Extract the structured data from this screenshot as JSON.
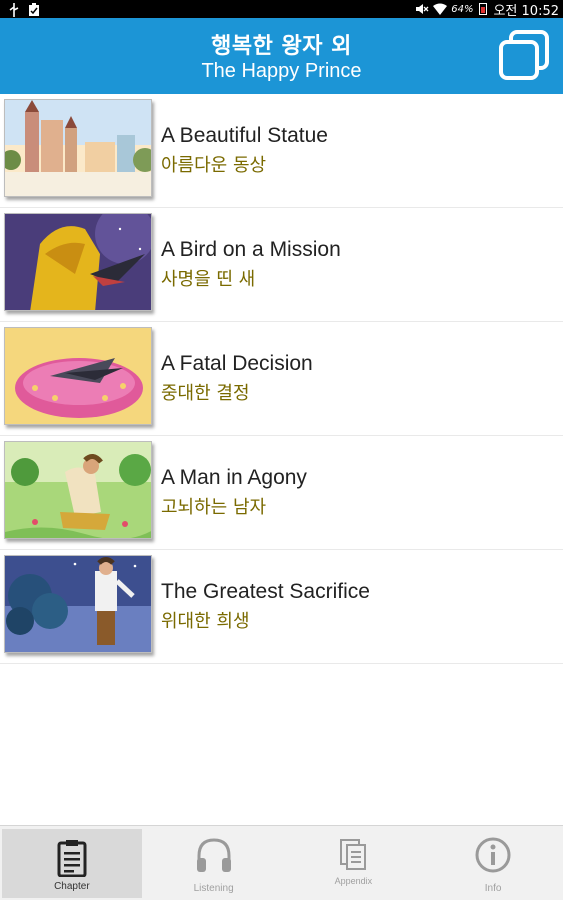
{
  "status_bar": {
    "left_icons": [
      "usb-icon",
      "clipboard-notification-icon"
    ],
    "battery_percent": "64%",
    "time": "오전 10:52"
  },
  "header": {
    "title_ko": "행복한 왕자 외",
    "title_en": "The Happy Prince",
    "window_button_icon": "multi-window-icon"
  },
  "chapters": [
    {
      "title": "A Beautiful Statue",
      "subtitle": "아름다운 동상"
    },
    {
      "title": "A Bird on a Mission",
      "subtitle": "사명을 띤 새"
    },
    {
      "title": "A Fatal Decision",
      "subtitle": "중대한 결정"
    },
    {
      "title": "A Man in Agony",
      "subtitle": "고뇌하는 남자"
    },
    {
      "title": "The Greatest Sacrifice",
      "subtitle": "위대한 희생"
    }
  ],
  "bottom_nav": {
    "tabs": [
      {
        "label": "Chapter",
        "icon": "clipboard-icon",
        "active": true
      },
      {
        "label": "Listening",
        "icon": "headphones-icon",
        "active": false
      },
      {
        "label": "Appendix",
        "icon": "documents-icon",
        "active": false
      },
      {
        "label": "Info",
        "icon": "info-icon",
        "active": false
      }
    ]
  },
  "colors": {
    "header_bg": "#1c95d6",
    "subtitle_text": "#7a6a00",
    "title_text": "#222222"
  }
}
